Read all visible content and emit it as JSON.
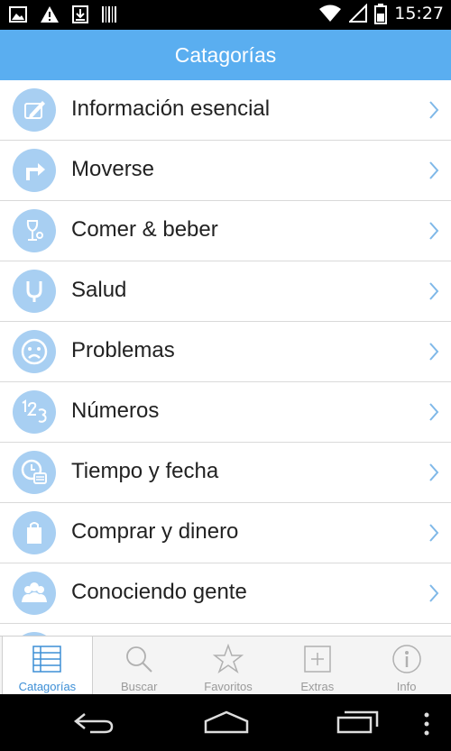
{
  "status_bar": {
    "time": "15:27",
    "icons": [
      "image-icon",
      "warning-icon",
      "download-icon",
      "barcode-icon",
      "wifi-icon",
      "signal-icon",
      "battery-icon"
    ]
  },
  "header": {
    "title": "Catagorías"
  },
  "categories": [
    {
      "label": "Información esencial",
      "icon": "pen-note-icon"
    },
    {
      "label": "Moverse",
      "icon": "turn-arrow-icon"
    },
    {
      "label": "Comer & beber",
      "icon": "wine-glass-icon"
    },
    {
      "label": "Salud",
      "icon": "stethoscope-icon"
    },
    {
      "label": "Problemas",
      "icon": "sad-face-icon"
    },
    {
      "label": "Números",
      "icon": "numbers-icon"
    },
    {
      "label": "Tiempo y fecha",
      "icon": "clock-calendar-icon"
    },
    {
      "label": "Comprar y dinero",
      "icon": "shopping-bag-icon"
    },
    {
      "label": "Conociendo gente",
      "icon": "people-icon"
    }
  ],
  "tabs": [
    {
      "label": "Catagorías",
      "icon": "list-icon",
      "active": true
    },
    {
      "label": "Buscar",
      "icon": "search-icon",
      "active": false
    },
    {
      "label": "Favoritos",
      "icon": "star-icon",
      "active": false
    },
    {
      "label": "Extras",
      "icon": "plus-box-icon",
      "active": false
    },
    {
      "label": "Info",
      "icon": "info-icon",
      "active": false
    }
  ],
  "colors": {
    "header": "#5aaef0",
    "icon_circle": "#a8cff2",
    "active_tab": "#3d8fd6",
    "inactive_tab": "#9a9a9a"
  }
}
